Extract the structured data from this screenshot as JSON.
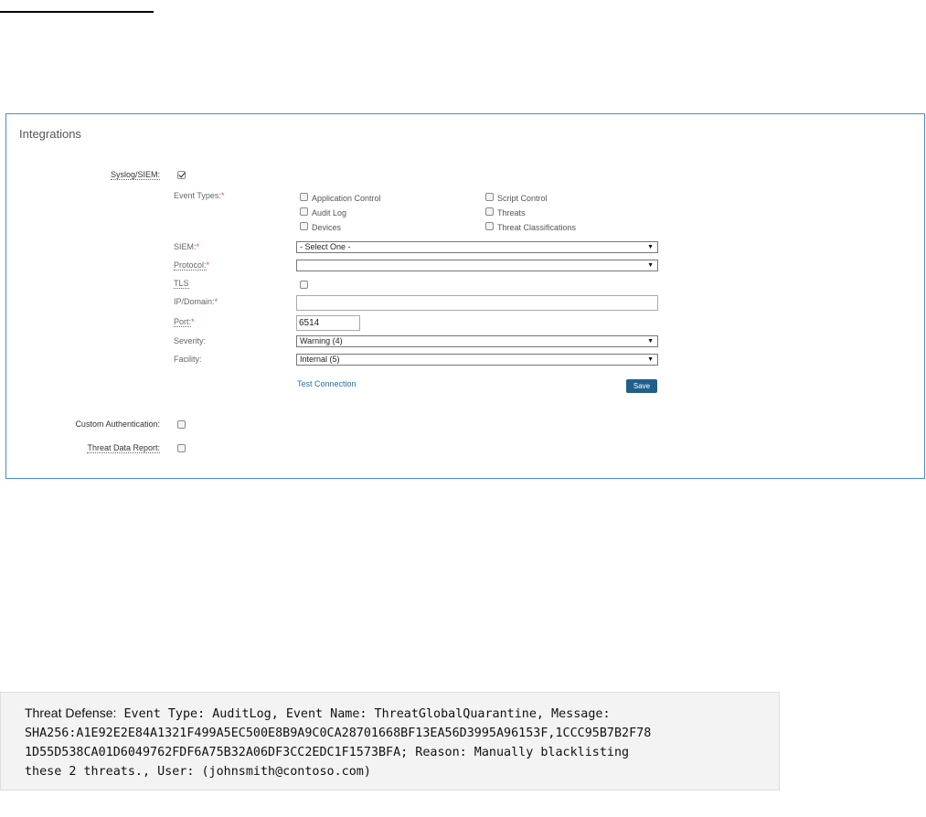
{
  "panel": {
    "title": "Integrations"
  },
  "syslog": {
    "label": "Syslog/SIEM:",
    "checked": true,
    "event_types": {
      "label": "Event Types:",
      "required": "*",
      "options": [
        {
          "label": "Application Control",
          "checked": false
        },
        {
          "label": "Audit Log",
          "checked": false
        },
        {
          "label": "Devices",
          "checked": false
        },
        {
          "label": "Script Control",
          "checked": false
        },
        {
          "label": "Threats",
          "checked": false
        },
        {
          "label": "Threat Classifications",
          "checked": false
        }
      ]
    },
    "siem": {
      "label": "SIEM:",
      "required": "*",
      "value": "- Select One -"
    },
    "protocol": {
      "label": "Protocol:",
      "required": "*",
      "value": ""
    },
    "tls": {
      "label": "TLS",
      "checked": false
    },
    "ip_domain": {
      "label": "IP/Domain:",
      "required": "*",
      "value": ""
    },
    "port": {
      "label": "Port:",
      "required": "*",
      "value": "6514"
    },
    "severity": {
      "label": "Severity:",
      "value": "Warning (4)"
    },
    "facility": {
      "label": "Facility:",
      "value": "Internal (5)"
    },
    "test_connection": "Test Connection",
    "save": "Save"
  },
  "custom_auth": {
    "label": "Custom Authentication:",
    "checked": false
  },
  "threat_data_report": {
    "label": "Threat Data Report:",
    "checked": false
  },
  "log": {
    "prefix": "Threat Defense:",
    "line1": " Event Type: AuditLog, Event Name: ThreatGlobalQuarantine, Message:",
    "line2": "SHA256:A1E92E2E84A1321F499A5EC500E8B9A9C0CA28701668BF13EA56D3995A96153F,1CCC95B7B2F78",
    "line3": "1D55D538CA01D6049762FDF6A75B32A06DF3CC2EDC1F1573BFA; Reason: Manually blacklisting",
    "line4": "these 2 threats., User: (johnsmith@contoso.com)"
  }
}
